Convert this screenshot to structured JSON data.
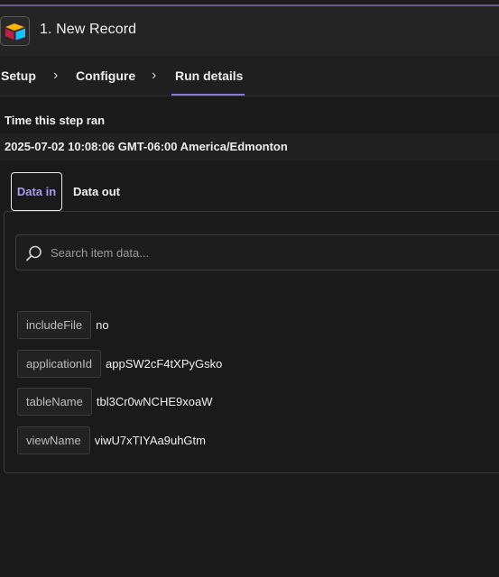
{
  "header": {
    "title": "1. New Record",
    "app_icon": "airtable-logo-icon"
  },
  "nav": {
    "items": [
      {
        "label": "Setup"
      },
      {
        "label": "Configure"
      },
      {
        "label": "Run details",
        "active": true
      }
    ],
    "separator": "›"
  },
  "run_info": {
    "time_label": "Time this step ran",
    "time_value": "2025-07-02 10:08:06 GMT-06:00 America/Edmonton"
  },
  "tabs": {
    "data_in": "Data in",
    "data_out": "Data out",
    "active": "Data in"
  },
  "search": {
    "placeholder": "Search item data...",
    "value": ""
  },
  "fields": [
    {
      "key": "includeFile",
      "value": "no"
    },
    {
      "key": "applicationId",
      "value": "appSW2cF4tXPyGsko"
    },
    {
      "key": "tableName",
      "value": "tbl3Cr0wNCHE9xoaW"
    },
    {
      "key": "viewName",
      "value": "viwU7xTIYAa9uhGtm"
    }
  ],
  "colors": {
    "accent": "#8c7ad9",
    "active_tab_text": "#a99bea",
    "background": "#1b1a1a"
  }
}
